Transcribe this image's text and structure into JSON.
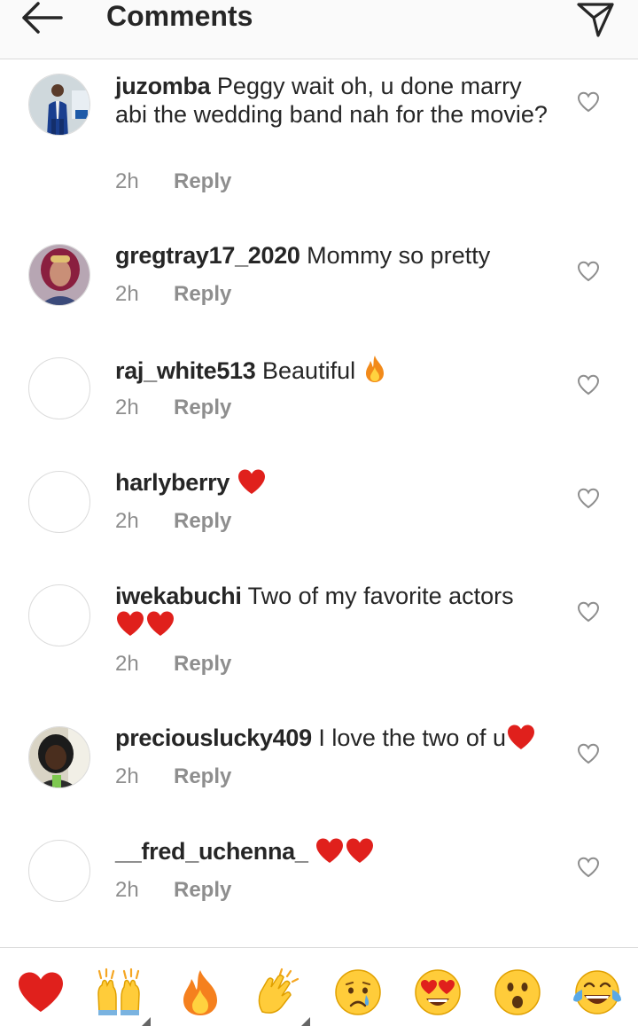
{
  "header": {
    "title": "Comments",
    "back_icon": "arrow-left-icon",
    "send_icon": "paper-plane-icon"
  },
  "comments": [
    {
      "username": "juzomba",
      "text": "Peggy wait oh, u done marry abi the wedding band nah for the movie?",
      "time": "2h",
      "reply": "Reply",
      "avatar": "photo",
      "emoji": ""
    },
    {
      "username": "gregtray17_2020",
      "text": "Mommy so pretty",
      "time": "2h",
      "reply": "Reply",
      "avatar": "photo",
      "emoji": ""
    },
    {
      "username": "raj_white513",
      "text": "Beautiful",
      "time": "2h",
      "reply": "Reply",
      "avatar": "empty",
      "emoji": "fire"
    },
    {
      "username": "harlyberry",
      "text": "",
      "time": "2h",
      "reply": "Reply",
      "avatar": "empty",
      "emoji": "red-heart"
    },
    {
      "username": "iwekabuchi",
      "text": "Two of my favorite actors",
      "time": "2h",
      "reply": "Reply",
      "avatar": "empty",
      "emoji": "two-red-hearts"
    },
    {
      "username": "preciouslucky409",
      "text": "I love the two of u",
      "time": "2h",
      "reply": "Reply",
      "avatar": "photo",
      "emoji": "red-heart"
    },
    {
      "username": "__fred_uchenna_",
      "text": "",
      "time": "2h",
      "reply": "Reply",
      "avatar": "empty",
      "emoji": "two-red-hearts"
    }
  ],
  "emoji_bar": [
    "red-heart-emoji",
    "raising-hands-emoji",
    "fire-emoji",
    "clapping-hands-emoji",
    "crying-face-emoji",
    "heart-eyes-emoji",
    "surprised-face-emoji",
    "tears-of-joy-emoji"
  ],
  "colors": {
    "text": "#262626",
    "muted": "#8e8e8e",
    "divider": "#dbdbdb",
    "heart_red": "#e0201c",
    "header_bg": "#fafafa"
  }
}
